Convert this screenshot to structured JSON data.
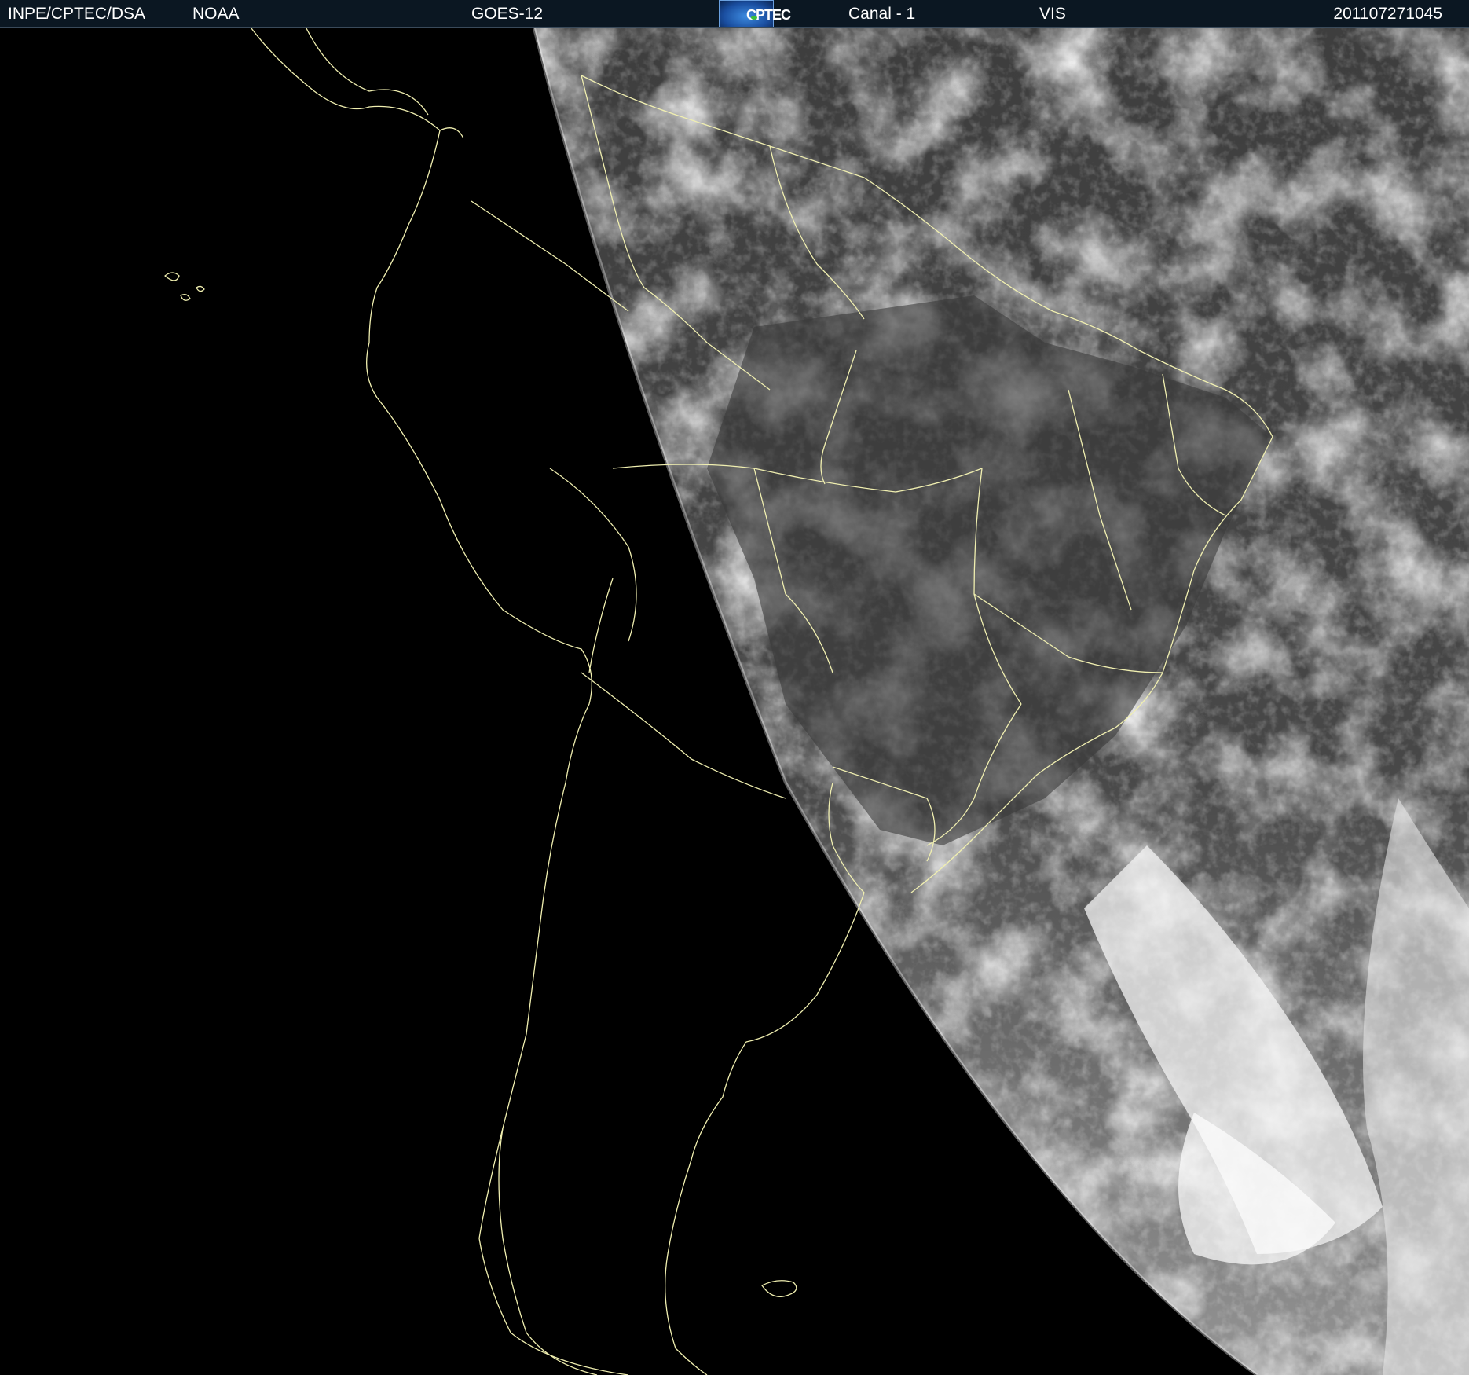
{
  "header": {
    "agency": "INPE/CPTEC/DSA",
    "provider": "NOAA",
    "satellite": "GOES-12",
    "logo_text": "CPTEC",
    "channel": "Canal - 1",
    "band": "VIS",
    "timestamp": "201107271045"
  },
  "colors": {
    "header_bg": "#0b1722",
    "space": "#000000",
    "earth_dark": "#3e3e3e",
    "cloud": "#e8e8e8",
    "borders": "#f0efb0"
  }
}
